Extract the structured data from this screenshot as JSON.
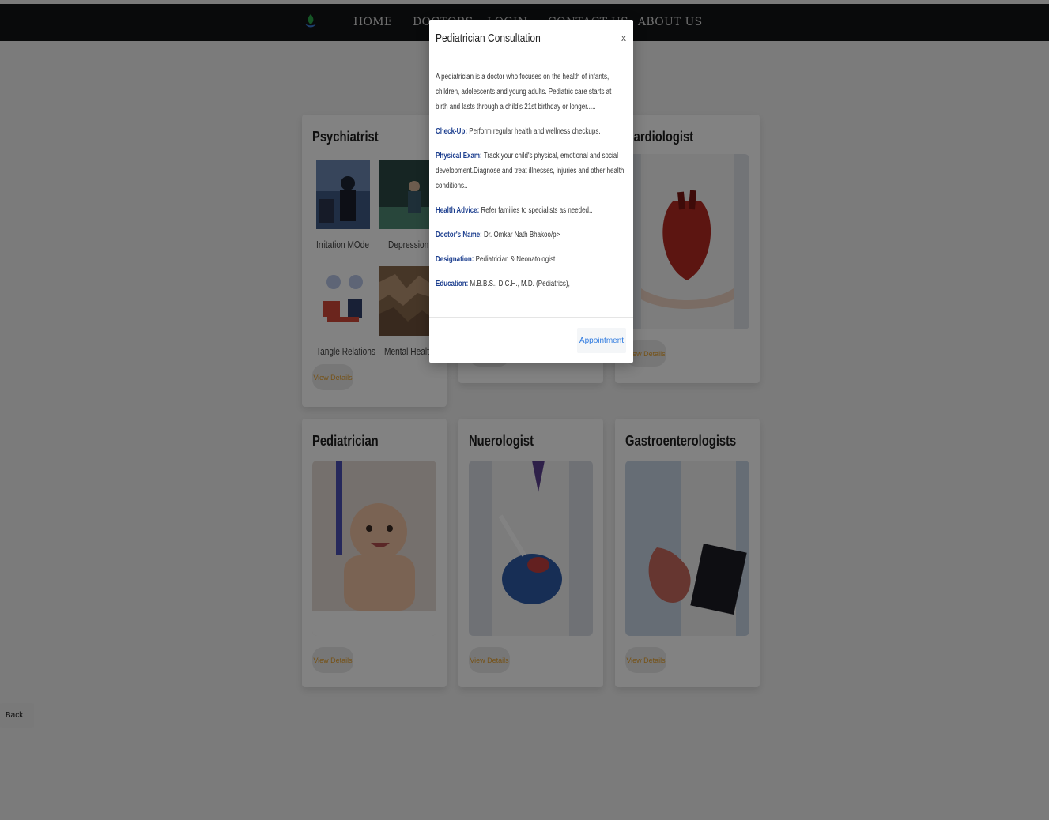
{
  "nav": {
    "items": [
      "HOME",
      "DOCTORS",
      "LOGIN",
      "CONTACT US",
      "ABOUT US"
    ]
  },
  "cards": {
    "psychiatrist": {
      "title": "Psychiatrist",
      "subs": [
        "Irritation MOde",
        "Depression",
        "Tangle Relations",
        "Mental Health"
      ],
      "view": "View Details"
    },
    "cardiologist": {
      "title": "Cardiologist",
      "view": "View Details"
    },
    "middle_top": {
      "view": "View Details"
    },
    "pediatrician": {
      "title": "Pediatrician",
      "view": "View Details"
    },
    "neurologist": {
      "title": "Nuerologist",
      "view": "View Details"
    },
    "gastro": {
      "title": "Gastroenterologists",
      "view": "View Details"
    }
  },
  "back_label": "Back",
  "modal": {
    "title": "Pediatrician Consultation",
    "close": "x",
    "intro": "A pediatrician is a doctor who focuses on the health of infants, children, adolescents and young adults. Pediatric care starts at birth and lasts through a child's 21st birthday or longer.....",
    "checkup_label": "Check-Up:",
    "checkup_text": " Perform regular health and wellness checkups.",
    "physical_label": "Physical Exam:",
    "physical_text": " Track your child's physical, emotional and social development.Diagnose and treat illnesses, injuries and other health conditions..",
    "advice_label": "Health Advice:",
    "advice_text": " Refer families to specialists as needed..",
    "name_label": "Doctor's Name:",
    "name_text": " Dr. Omkar Nath Bhakoo/p>",
    "designation_label": "Designation:",
    "designation_text": " Pediatrician & Neonatologist",
    "education_label": "Education:",
    "education_text": " M.B.B.S., D.C.H., M.D. (Pediatrics),",
    "appointment": "Appointment"
  },
  "colors": {
    "navbar": "#121416",
    "accent_link": "#2f7be0",
    "view_details": "#e7a12d",
    "label_blue": "#1d3f8f"
  }
}
